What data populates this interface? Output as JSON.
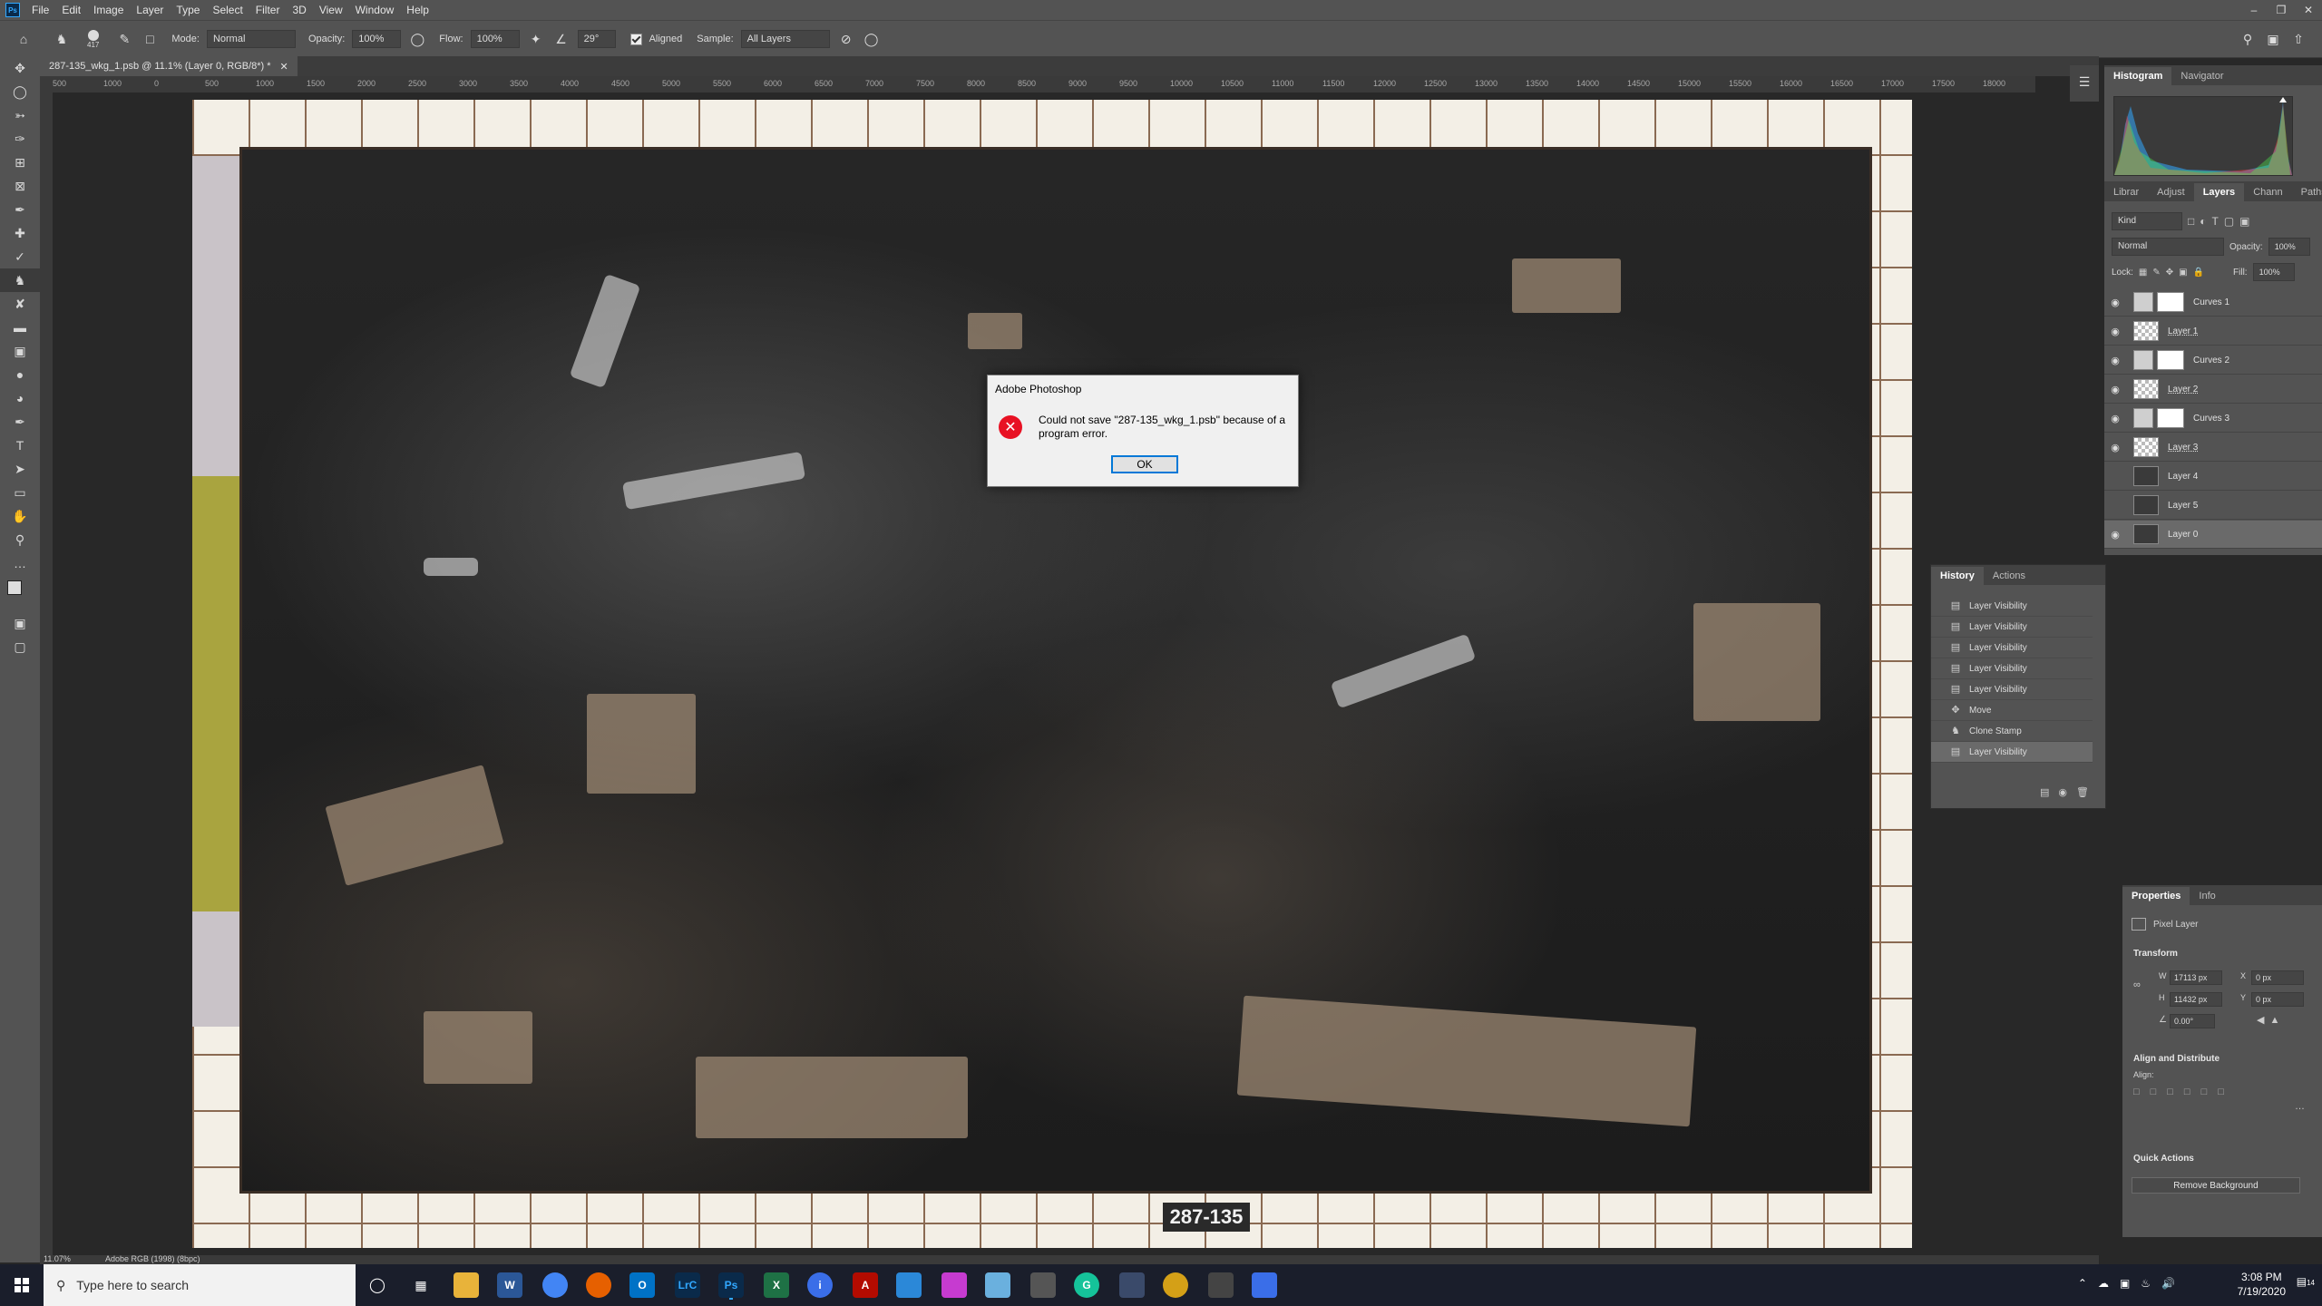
{
  "menu": {
    "logo": "Ps",
    "items": [
      "File",
      "Edit",
      "Image",
      "Layer",
      "Type",
      "Select",
      "Filter",
      "3D",
      "View",
      "Window",
      "Help"
    ]
  },
  "options_bar": {
    "brush_size": "417",
    "mode_label": "Mode:",
    "mode_value": "Normal",
    "opacity_label": "Opacity:",
    "opacity_value": "100%",
    "flow_label": "Flow:",
    "flow_value": "100%",
    "angle_value": "29°",
    "aligned_label": "Aligned",
    "sample_label": "Sample:",
    "sample_value": "All Layers"
  },
  "document": {
    "tab_title": "287-135_wkg_1.psb @ 11.1% (Layer 0, RGB/8*) *",
    "label_text": "287-135",
    "zoom": "11.07%",
    "color_profile": "Adobe RGB (1998) (8bpc)"
  },
  "ruler_ticks": [
    "500",
    "1000",
    "0",
    "500",
    "1000",
    "1500",
    "2000",
    "2500",
    "3000",
    "3500",
    "4000",
    "4500",
    "5000",
    "5500",
    "6000",
    "6500",
    "7000",
    "7500",
    "8000",
    "8500",
    "9000",
    "9500",
    "10000",
    "10500",
    "11000",
    "11500",
    "12000",
    "12500",
    "13000",
    "13500",
    "14000",
    "14500",
    "15000",
    "15500",
    "16000",
    "16500",
    "17000",
    "17500",
    "18000"
  ],
  "dialog": {
    "title": "Adobe Photoshop",
    "message": "Could not save \"287-135_wkg_1.psb\" because of a program error.",
    "ok_label": "OK"
  },
  "histogram_panel": {
    "tabs": [
      "Histogram",
      "Navigator"
    ]
  },
  "layers_panel": {
    "tabs": [
      "Librar",
      "Adjust",
      "Layers",
      "Chann",
      "Paths"
    ],
    "kind_label": "Kind",
    "blend_mode": "Normal",
    "opacity_label": "Opacity:",
    "opacity_value": "100%",
    "lock_label": "Lock:",
    "fill_label": "Fill:",
    "fill_value": "100%",
    "layers": [
      {
        "name": "Curves 1",
        "type": "adjustment",
        "visible": true
      },
      {
        "name": "Layer 1",
        "type": "pixel",
        "visible": true
      },
      {
        "name": "Curves 2",
        "type": "adjustment",
        "visible": true
      },
      {
        "name": "Layer 2",
        "type": "pixel",
        "visible": true
      },
      {
        "name": "Curves 3",
        "type": "adjustment",
        "visible": true
      },
      {
        "name": "Layer 3",
        "type": "pixel",
        "visible": true
      },
      {
        "name": "Layer 4",
        "type": "image",
        "visible": false
      },
      {
        "name": "Layer 5",
        "type": "image",
        "visible": false
      },
      {
        "name": "Layer 0",
        "type": "image",
        "visible": true,
        "selected": true
      }
    ]
  },
  "history_panel": {
    "tabs": [
      "History",
      "Actions"
    ],
    "items": [
      {
        "label": "Layer Visibility",
        "icon": "doc-icon"
      },
      {
        "label": "Layer Visibility",
        "icon": "doc-icon"
      },
      {
        "label": "Layer Visibility",
        "icon": "doc-icon"
      },
      {
        "label": "Layer Visibility",
        "icon": "doc-icon"
      },
      {
        "label": "Layer Visibility",
        "icon": "doc-icon"
      },
      {
        "label": "Move",
        "icon": "move-icon"
      },
      {
        "label": "Clone Stamp",
        "icon": "stamp-icon"
      },
      {
        "label": "Layer Visibility",
        "icon": "doc-icon",
        "selected": true
      }
    ]
  },
  "properties_panel": {
    "tabs": [
      "Properties",
      "Info"
    ],
    "layer_type": "Pixel Layer",
    "transform_label": "Transform",
    "w_label": "W",
    "w_value": "17113 px",
    "h_label": "H",
    "h_value": "11432 px",
    "x_label": "X",
    "x_value": "0 px",
    "y_label": "Y",
    "y_value": "0 px",
    "angle_value": "0.00°",
    "align_label": "Align and Distribute",
    "align_sub": "Align:",
    "quick_actions_label": "Quick Actions",
    "remove_bg_label": "Remove Background"
  },
  "taskbar": {
    "search_placeholder": "Type here to search",
    "time": "3:08 PM",
    "date": "7/19/2020",
    "notification_count": "14"
  }
}
